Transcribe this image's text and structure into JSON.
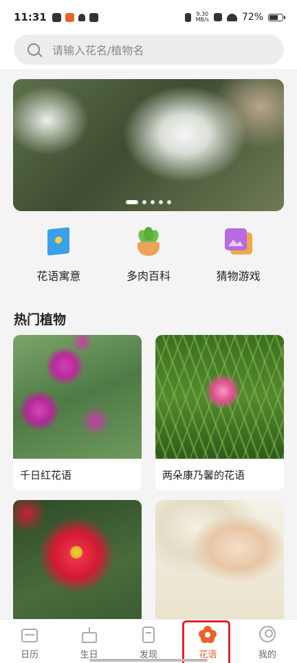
{
  "status_bar": {
    "time": "11:31",
    "net_speed_value": "9.30",
    "net_speed_unit": "MB/s",
    "battery": "72%"
  },
  "search": {
    "placeholder": "请输入花名/植物名"
  },
  "banner": {
    "dots_total": 5,
    "active_index": 0
  },
  "quick_entries": [
    {
      "label": "花语寓意",
      "icon": "book-icon"
    },
    {
      "label": "多肉百科",
      "icon": "succulent-icon"
    },
    {
      "label": "猜物游戏",
      "icon": "picture-game-icon"
    }
  ],
  "section": {
    "title": "热门植物"
  },
  "plants": [
    {
      "name": "千日红花语"
    },
    {
      "name": "两朵康乃馨的花语"
    },
    {
      "name": ""
    },
    {
      "name": ""
    }
  ],
  "bottom_nav": [
    {
      "label": "日历",
      "icon": "calendar-icon"
    },
    {
      "label": "生日",
      "icon": "cake-icon"
    },
    {
      "label": "发现",
      "icon": "discover-icon"
    },
    {
      "label": "花语",
      "icon": "flower-icon",
      "active": true
    },
    {
      "label": "我的",
      "icon": "profile-icon"
    }
  ],
  "colors": {
    "accent": "#e8632b",
    "highlight_border": "#e8202a",
    "background": "#f4f4f4"
  }
}
